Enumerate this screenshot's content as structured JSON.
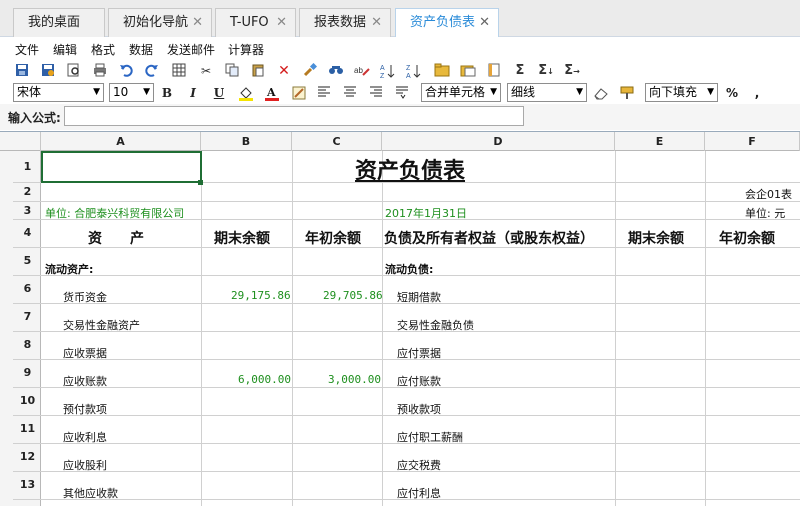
{
  "tabs": [
    {
      "label": "我的桌面",
      "closable": false
    },
    {
      "label": "初始化导航",
      "closable": true
    },
    {
      "label": "T-UFO",
      "closable": true
    },
    {
      "label": "报表数据",
      "closable": true
    },
    {
      "label": "资产负债表",
      "closable": true,
      "active": true
    }
  ],
  "tab_close_glyph": "✕",
  "menu": [
    "文件",
    "编辑",
    "格式",
    "数据",
    "发送邮件",
    "计算器"
  ],
  "format": {
    "font": "宋体",
    "size": "10",
    "bold": "B",
    "italic": "I",
    "underline": "U",
    "merge": "合并单元格",
    "border": "细线",
    "fill": "向下填充",
    "percent": "%",
    "comma": ","
  },
  "formula": {
    "label": "输入公式:",
    "value": ""
  },
  "columns": [
    "A",
    "B",
    "C",
    "D",
    "E",
    "F"
  ],
  "rows": [
    "1",
    "2",
    "3",
    "4",
    "5",
    "6",
    "7",
    "8",
    "9",
    "10",
    "11",
    "12",
    "13"
  ],
  "sheet": {
    "title": "资产负债表",
    "form_code": "会企01表",
    "company": "单位: 合肥泰兴科贸有限公司",
    "date": "2017年1月31日",
    "unit": "单位: 元",
    "headers": {
      "asset": "资　　产",
      "end_balance": "期末余额",
      "begin_balance": "年初余额",
      "liab": "负债及所有者权益（或股东权益）",
      "end_balance2": "期末余额",
      "begin_balance2": "年初余额"
    },
    "left": [
      {
        "label": "流动资产:",
        "end": "",
        "begin": ""
      },
      {
        "label": "货币资金",
        "end": "29,175.86",
        "begin": "29,705.86"
      },
      {
        "label": "交易性金融资产",
        "end": "",
        "begin": ""
      },
      {
        "label": "应收票据",
        "end": "",
        "begin": ""
      },
      {
        "label": "应收账款",
        "end": "6,000.00",
        "begin": "3,000.00"
      },
      {
        "label": "预付款项",
        "end": "",
        "begin": ""
      },
      {
        "label": "应收利息",
        "end": "",
        "begin": ""
      },
      {
        "label": "应收股利",
        "end": "",
        "begin": ""
      },
      {
        "label": "其他应收款",
        "end": "",
        "begin": ""
      }
    ],
    "right": [
      "流动负债:",
      "短期借款",
      "交易性金融负债",
      "应付票据",
      "应付账款",
      "预收款项",
      "应付职工薪酬",
      "应交税费",
      "应付利息"
    ]
  },
  "icons": {
    "toolbar": [
      "save-icon",
      "save-as-icon",
      "print-preview-icon",
      "print-icon",
      "undo-icon",
      "redo-icon",
      "grid-icon",
      "cut-icon",
      "copy-icon",
      "paste-icon",
      "delete-icon",
      "brush-icon",
      "find-icon",
      "replace-icon",
      "sort-asc-icon",
      "sort-desc-icon",
      "folder-icon",
      "folder-open-icon",
      "sheet-icon",
      "sum-icon",
      "sum-row-icon",
      "sum-col-icon"
    ]
  }
}
